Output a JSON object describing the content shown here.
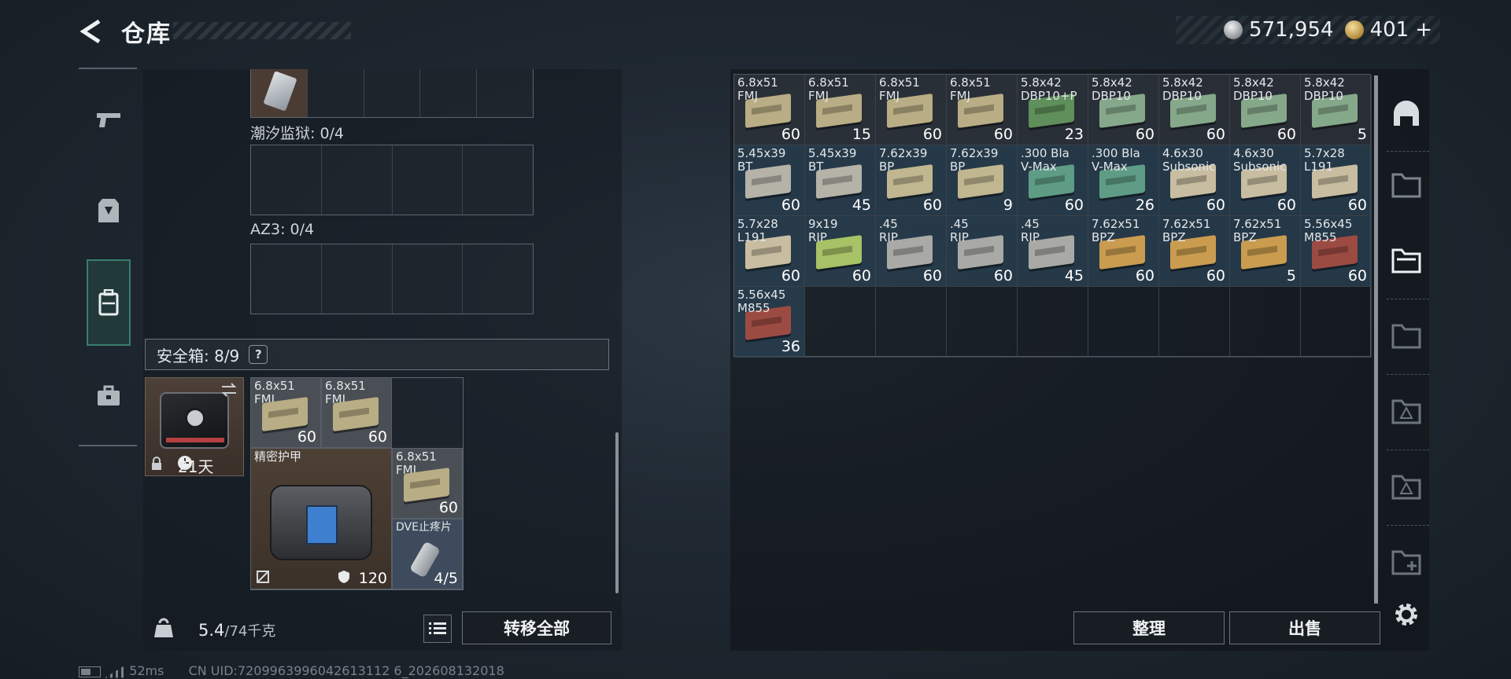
{
  "header": {
    "title": "仓库",
    "currency_silver": "571,954",
    "currency_gold": "401",
    "currency_add": "+"
  },
  "left": {
    "container1_label": "潮汐监狱: 0/4",
    "container2_label": "AZ3: 0/4",
    "safe_box_label": "安全箱:  8/9",
    "safe_help": "?",
    "safe_days": "21天",
    "items": [
      {
        "name": "6.8x51\nFMJ",
        "count": "60"
      },
      {
        "name": "6.8x51\nFMJ",
        "count": "60"
      },
      {
        "name": "精密护甲",
        "count": "120"
      },
      {
        "name": "6.8x51\nFMJ",
        "count": "60"
      },
      {
        "name": "DVE止疼片",
        "count": "4/5"
      }
    ],
    "weight_value": "5.4",
    "weight_max": "/74千克",
    "transfer_all": "转移全部"
  },
  "right": {
    "items": [
      {
        "name": "6.8x51\nFMJ",
        "count": "60",
        "color": "#b9ad85"
      },
      {
        "name": "6.8x51\nFMJ",
        "count": "15",
        "color": "#b9ad85"
      },
      {
        "name": "6.8x51\nFMJ",
        "count": "60",
        "color": "#b9ad85"
      },
      {
        "name": "6.8x51\nFMJ",
        "count": "60",
        "color": "#b9ad85"
      },
      {
        "name": "5.8x42\nDBP10+P",
        "count": "23",
        "color": "#5f8f5b"
      },
      {
        "name": "5.8x42\nDBP10",
        "count": "60",
        "color": "#86a88a"
      },
      {
        "name": "5.8x42\nDBP10",
        "count": "60",
        "color": "#86a88a"
      },
      {
        "name": "5.8x42\nDBP10",
        "count": "60",
        "color": "#86a88a"
      },
      {
        "name": "5.8x42\nDBP10",
        "count": "5",
        "color": "#86a88a"
      },
      {
        "name": "5.45x39\nBT",
        "count": "60",
        "color": "#b5b2a8"
      },
      {
        "name": "5.45x39\nBT",
        "count": "45",
        "color": "#b5b2a8"
      },
      {
        "name": "7.62x39\nBP",
        "count": "60",
        "color": "#c0b68f"
      },
      {
        "name": "7.62x39\nBP",
        "count": "9",
        "color": "#c0b68f"
      },
      {
        "name": ".300 Bla\nV-Max",
        "count": "60",
        "color": "#5e9c86"
      },
      {
        "name": ".300 Bla\nV-Max",
        "count": "26",
        "color": "#5e9c86"
      },
      {
        "name": "4.6x30\nSubsonic",
        "count": "60",
        "color": "#c8bda0"
      },
      {
        "name": "4.6x30\nSubsonic",
        "count": "60",
        "color": "#c8bda0"
      },
      {
        "name": "5.7x28\nL191",
        "count": "60",
        "color": "#c8bda0"
      },
      {
        "name": "5.7x28\nL191",
        "count": "60",
        "color": "#c8bda0"
      },
      {
        "name": "9x19\nRIP",
        "count": "60",
        "color": "#a7c267"
      },
      {
        "name": ".45\nRIP",
        "count": "60",
        "color": "#a9a9a5"
      },
      {
        "name": ".45\nRIP",
        "count": "60",
        "color": "#a9a9a5"
      },
      {
        "name": ".45\nRIP",
        "count": "45",
        "color": "#a9a9a5"
      },
      {
        "name": "7.62x51\nBPZ",
        "count": "60",
        "color": "#c99c4f"
      },
      {
        "name": "7.62x51\nBPZ",
        "count": "60",
        "color": "#c99c4f"
      },
      {
        "name": "7.62x51\nBPZ",
        "count": "5",
        "color": "#c99c4f"
      },
      {
        "name": "5.56x45\nM855",
        "count": "60",
        "color": "#9c4b43"
      },
      {
        "name": "5.56x45\nM855",
        "count": "36",
        "color": "#9c4b43"
      }
    ],
    "sort_button": "整理",
    "sell_button": "出售"
  },
  "status": {
    "ping": "52ms",
    "uid": "CN UID:7209963996042613112 6_202608132018"
  }
}
